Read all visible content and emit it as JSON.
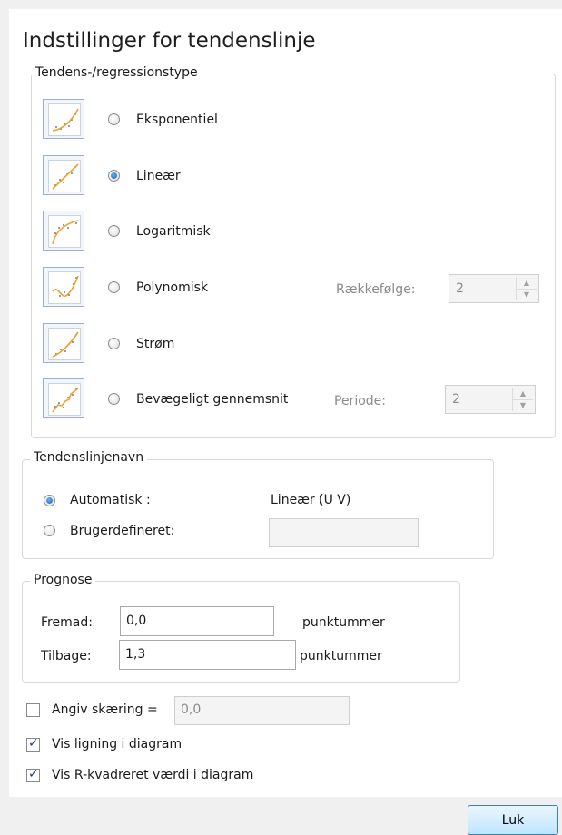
{
  "dialog": {
    "title": "Indstillinger for tendenslinje"
  },
  "trend_type": {
    "legend": "Tendens-/regressionstype",
    "options": [
      {
        "label": "Eksponentiel",
        "icon": "exponential-trend-icon",
        "selected": false
      },
      {
        "label": "Lineær",
        "icon": "linear-trend-icon",
        "selected": true
      },
      {
        "label": "Logaritmisk",
        "icon": "logarithmic-trend-icon",
        "selected": false
      },
      {
        "label": "Polynomisk",
        "icon": "polynomial-trend-icon",
        "selected": false
      },
      {
        "label": "Strøm",
        "icon": "power-trend-icon",
        "selected": false
      },
      {
        "label": "Bevægeligt gennemsnit",
        "icon": "moving-average-trend-icon",
        "selected": false
      }
    ],
    "order_label": "Rækkefølge:",
    "order_value": "2",
    "period_label": "Periode:",
    "period_value": "2"
  },
  "trend_name": {
    "legend": "Tendenslinjenavn",
    "automatic_label": "Automatisk :",
    "automatic_value": "Lineær (U V)",
    "custom_label": "Brugerdefineret:",
    "custom_value": ""
  },
  "forecast": {
    "legend": "Prognose",
    "forward_label": "Fremad:",
    "forward_value": "0,0",
    "forward_unit": "punktummer",
    "backward_label": "Tilbage:",
    "backward_value": "1,3",
    "backward_unit": "punktummer"
  },
  "options": {
    "intercept_label": "Angiv skæring =",
    "intercept_value": "0,0",
    "intercept_checked": false,
    "show_equation_label": "Vis ligning i diagram",
    "show_equation_checked": true,
    "show_r2_label": "Vis R-kvadreret værdi i diagram",
    "show_r2_checked": true
  },
  "footer": {
    "close_label": "Luk"
  },
  "colors": {
    "accent": "#1a5fb4",
    "trend_line": "#f0a030",
    "button_border": "#3c7fb1"
  }
}
